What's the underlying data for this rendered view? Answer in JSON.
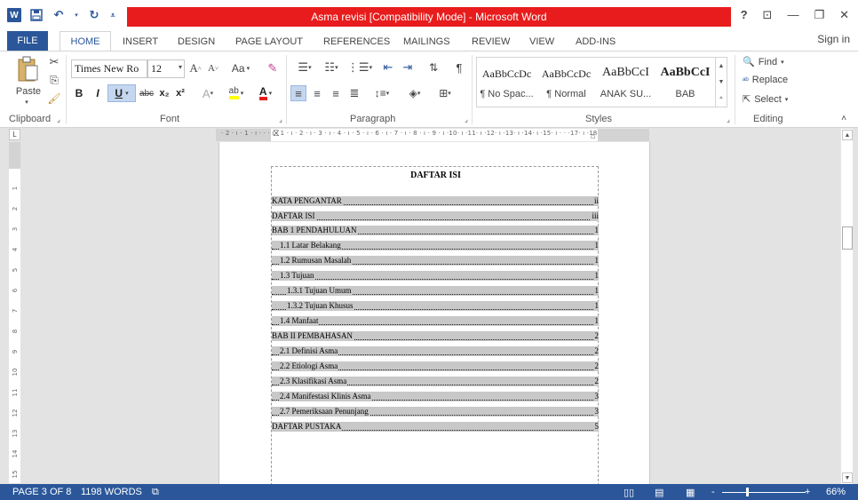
{
  "window": {
    "title": "Asma revisi [Compatibility Mode] - Microsoft Word",
    "help": "?",
    "controls": [
      "⊡",
      "—",
      "❐",
      "✕"
    ]
  },
  "quick_access": {
    "icons": [
      "word-logo",
      "save-icon",
      "undo-icon",
      "redo-icon",
      "customize-qat-icon"
    ]
  },
  "tabs": [
    "FILE",
    "HOME",
    "INSERT",
    "DESIGN",
    "PAGE LAYOUT",
    "REFERENCES",
    "MAILINGS",
    "REVIEW",
    "VIEW",
    "ADD-INS"
  ],
  "active_tab": "HOME",
  "sign_in": "Sign in",
  "ribbon": {
    "clipboard": {
      "label": "Clipboard",
      "paste": "Paste"
    },
    "font": {
      "label": "Font",
      "font_name": "Times New Ro",
      "font_size": "12",
      "change_case": "Aa",
      "bold": "B",
      "italic": "I",
      "underline": "U",
      "strikethrough": "abc",
      "subscript": "x₂",
      "superscript": "x²"
    },
    "paragraph": {
      "label": "Paragraph"
    },
    "styles": {
      "label": "Styles",
      "items": [
        {
          "sample": "AaBbCcDc",
          "name": "¶ No Spac..."
        },
        {
          "sample": "AaBbCcDc",
          "name": "¶ Normal"
        },
        {
          "sample": "AaBbCcI",
          "name": "ANAK SU..."
        },
        {
          "sample": "AaBbCcI",
          "name": "BAB"
        }
      ]
    },
    "editing": {
      "label": "Editing",
      "find": "Find",
      "replace": "Replace",
      "select": "Select"
    }
  },
  "ruler_top": "· 2 · ı · 1 · ı ·  ·  · ı · 1 · ı · 2 · ı · 3 · ı · 4 · ı · 5 · ı · 6 · ı · 7 · ı · 8 · ı · 9 · ı ·10· ı ·11· ı ·12· ı ·13· ı ·14· ı ·15· ı ·  ·  ·17· ı ·18",
  "ruler_left": [
    "1",
    "2",
    "3",
    "4",
    "5",
    "6",
    "7",
    "8",
    "9",
    "10",
    "11",
    "12",
    "13",
    "14",
    "15"
  ],
  "document": {
    "title": "DAFTAR ISI",
    "toc": [
      {
        "text": "KATA PENGANTAR",
        "page": "ii",
        "indent": 0
      },
      {
        "text": "DAFTAR ISI",
        "page": "iii",
        "indent": 0
      },
      {
        "text": "BAB 1 PENDAHULUAN",
        "page": "1",
        "indent": 0
      },
      {
        "text": "1.1 Latar Belakang",
        "page": "1",
        "indent": 1
      },
      {
        "text": "1.2 Rumusan Masalah",
        "page": "1",
        "indent": 1
      },
      {
        "text": "1.3 Tujuan",
        "page": "1",
        "indent": 1
      },
      {
        "text": "1.3.1 Tujuan Umum",
        "page": "1",
        "indent": 2
      },
      {
        "text": "1.3.2 Tujuan Khusus",
        "page": "1",
        "indent": 2
      },
      {
        "text": "1.4 Manfaat",
        "page": "1",
        "indent": 1
      },
      {
        "text": "BAB II PEMBAHASAN",
        "page": "2",
        "indent": 0
      },
      {
        "text": "2.1 Definisi Asma",
        "page": "2",
        "indent": 1
      },
      {
        "text": "2.2 Etiologi Asma",
        "page": "2",
        "indent": 1
      },
      {
        "text": "2.3 Klasifikasi Asma",
        "page": "2",
        "indent": 1
      },
      {
        "text": "2.4 Manifestasi Klinis Asma",
        "page": "3",
        "indent": 1
      },
      {
        "text": "2.7 Pemeriksaan Penunjang",
        "page": "3",
        "indent": 1
      },
      {
        "text": "DAFTAR PUSTAKA",
        "page": "5",
        "indent": 0
      }
    ]
  },
  "status": {
    "page": "PAGE 3 OF 8",
    "words": "1198 WORDS",
    "zoom": "66%",
    "zoom_minus": "-",
    "zoom_plus": "+"
  },
  "colors": {
    "brand": "#2b579a",
    "title_bar_red": "#e81c1c",
    "field_shading": "#c8c8c8"
  }
}
